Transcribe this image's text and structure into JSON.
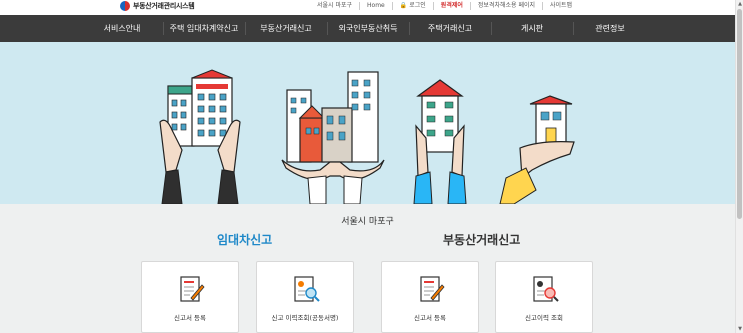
{
  "header": {
    "logo_text": "부동산거래관리시스템",
    "util_links": [
      "서울시 마포구",
      "Home",
      "로그인",
      "원격제어",
      "정보격차해소용 페이지",
      "사이트맵"
    ]
  },
  "nav": {
    "items": [
      "서비스안내",
      "주택 임대차계약신고",
      "부동산거래신고",
      "외국인부동산취득",
      "주택거래신고",
      "게시판",
      "관련정보"
    ]
  },
  "main": {
    "region": "서울시 마포구",
    "lease_title": "임대차신고",
    "trade_title": "부동산거래신고",
    "cards": [
      {
        "label": "신고서 등록"
      },
      {
        "label": "신고 이력조회(공동서명)"
      },
      {
        "label": "신고서 등록"
      },
      {
        "label": "신고이력 조회"
      }
    ]
  },
  "colors": {
    "nav_bg": "#3b3b3b",
    "hero_bg": "#cfe9f1",
    "lease_title": "#1e88c8",
    "trade_title": "#333333",
    "accent_red": "#d32f2f"
  }
}
